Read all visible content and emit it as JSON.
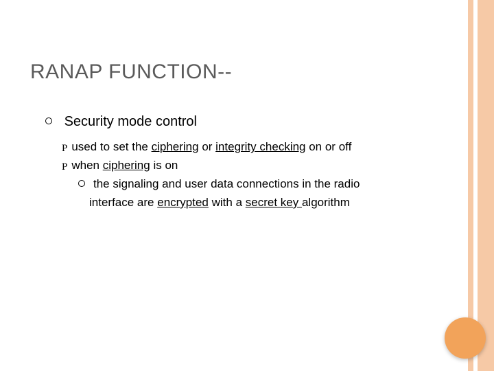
{
  "title": "RANAP FUNCTION--",
  "level1": {
    "text": "Security mode control"
  },
  "level2a": {
    "pre": "used to set the ",
    "u1": "ciphering",
    "mid": " or ",
    "u2": "integrity checking",
    "post": " on or off"
  },
  "level2b": {
    "pre": "when ",
    "u1": "ciphering",
    "post": " is on"
  },
  "level3": {
    "line1": "the signaling and user data connections in the radio",
    "line2_pre": "interface are ",
    "line2_u1": "encrypted",
    "line2_mid": " with a ",
    "line2_u2": "secret key ",
    "line2_post": "algorithm"
  },
  "bullet_script": "P"
}
